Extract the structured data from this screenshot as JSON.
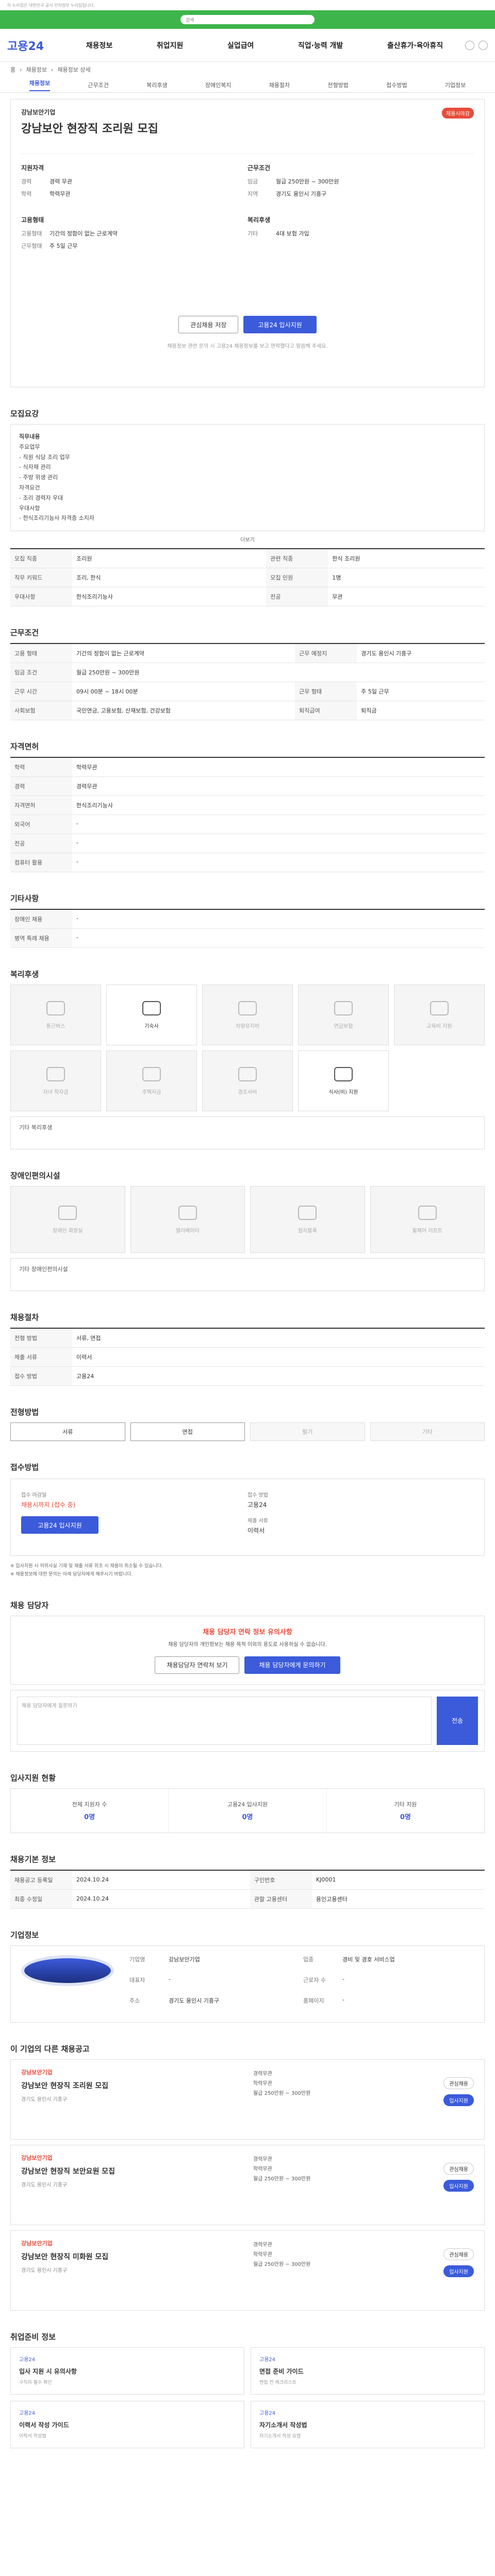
{
  "topbar": {
    "text": "이 누리집은 대한민국 공식 전자정부 누리집입니다."
  },
  "search": {
    "placeholder": "검색"
  },
  "header": {
    "logo": "고용24",
    "gnb": [
      "채용정보",
      "취업지원",
      "실업급여",
      "직업·능력 개발",
      "출산휴가·육아휴직"
    ]
  },
  "breadcrumb": [
    "홈",
    "채용정보",
    "채용정보 상세"
  ],
  "subnav": [
    "채용정보",
    "근무조건",
    "복리후생",
    "장애인복지",
    "채용절차",
    "전형방법",
    "접수방법",
    "기업정보"
  ],
  "posting": {
    "company": "강남보안기업",
    "title": "강남보안 현장직 조리원 모집",
    "status": "채용시마감",
    "left_head": "지원자격",
    "left": [
      {
        "k": "경력",
        "v": "경력 무관"
      },
      {
        "k": "학력",
        "v": "학력무관"
      }
    ],
    "left2_head": "고용형태",
    "left2": [
      {
        "k": "고용형태",
        "v": "기간의 정함이 없는 근로계약"
      },
      {
        "k": "근무형태",
        "v": "주 5일 근무"
      }
    ],
    "right_head": "근무조건",
    "right": [
      {
        "k": "임금",
        "v": "월급 250만원 ~ 300만원"
      },
      {
        "k": "지역",
        "v": "경기도 용인시 기흥구"
      }
    ],
    "right2_head": "복리후생",
    "right2": [
      {
        "k": "기타",
        "v": "4대 보험 가입"
      }
    ],
    "btn_save": "관심채용 저장",
    "btn_apply": "고용24 입사지원",
    "note": "채용정보 관련 문의 시 고용24 채용정보를 보고 연락했다고 말씀해 주세요."
  },
  "recruit": {
    "heading": "모집요강",
    "desc_title": "직무내용",
    "desc_lines": [
      "주요업무",
      "- 직원 식당 조리 업무",
      "- 식자재 관리",
      "- 주방 위생 관리",
      "자격요건",
      "- 조리 경력자 우대",
      "우대사항",
      "- 한식조리기능사 자격증 소지자"
    ],
    "more": "더보기",
    "rows": [
      {
        "k": "모집 직종",
        "v": "조리원"
      },
      {
        "k": "관련 직종",
        "v": "한식 조리원"
      },
      {
        "k": "직무 키워드",
        "v": "조리, 한식"
      },
      {
        "k": "모집 인원",
        "v": "1명"
      },
      {
        "k": "우대사항",
        "v": "한식조리기능사"
      },
      {
        "k": "전공",
        "v": "무관"
      }
    ]
  },
  "conditions": {
    "heading": "근무조건",
    "rows": [
      {
        "k": "고용 형태",
        "v": "기간의 정함이 없는 근로계약"
      },
      {
        "k": "근무 예정지",
        "v": "경기도 용인시 기흥구"
      },
      {
        "k": "임금 조건",
        "v": "월급 250만원 ~ 300만원"
      },
      {
        "k": "근무 시간",
        "v": "09시 00분 ~ 18시 00분"
      },
      {
        "k": "근무 형태",
        "v": "주 5일 근무"
      },
      {
        "k": "사회보험",
        "v": "국민연금, 고용보험, 산재보험, 건강보험"
      },
      {
        "k": "퇴직급여",
        "v": "퇴직금"
      }
    ]
  },
  "qualification": {
    "heading": "자격면허",
    "rows": [
      {
        "k": "학력",
        "v": "학력무관"
      },
      {
        "k": "경력",
        "v": "경력무관"
      },
      {
        "k": "자격면허",
        "v": "한식조리기능사"
      },
      {
        "k": "외국어",
        "v": "-"
      },
      {
        "k": "전공",
        "v": "-"
      },
      {
        "k": "컴퓨터 활용",
        "v": "-"
      }
    ]
  },
  "etc": {
    "heading": "기타사항",
    "rows": [
      {
        "k": "장애인 채용",
        "v": "-"
      },
      {
        "k": "병역 특례 채용",
        "v": "-"
      }
    ]
  },
  "welfare": {
    "heading": "복리후생",
    "items": [
      {
        "label": "통근버스",
        "on": false
      },
      {
        "label": "기숙사",
        "on": true
      },
      {
        "label": "차량유지비",
        "on": false
      },
      {
        "label": "연금보험",
        "on": false
      },
      {
        "label": "교육비 지원",
        "on": false
      },
      {
        "label": "자녀 학자금",
        "on": false
      },
      {
        "label": "주택자금",
        "on": false
      },
      {
        "label": "경조사비",
        "on": false
      },
      {
        "label": "식사(비) 지원",
        "on": true
      }
    ],
    "etc_label": "기타 복리후생"
  },
  "disability": {
    "heading": "장애인편의시설",
    "items": [
      "장애인 화장실",
      "엘리베이터",
      "점자블록",
      "휠체어 리프트"
    ],
    "etc_label": "기타 장애인편의시설"
  },
  "process": {
    "heading": "채용절차",
    "rows": [
      {
        "k": "전형 방법",
        "v": "서류, 면접"
      },
      {
        "k": "제출 서류",
        "v": "이력서"
      },
      {
        "k": "접수 방법",
        "v": "고용24"
      }
    ]
  },
  "method": {
    "heading": "전형방법",
    "types": [
      {
        "label": "서류",
        "on": true
      },
      {
        "label": "면접",
        "on": true
      },
      {
        "label": "필기",
        "on": false
      },
      {
        "label": "기타",
        "on": false
      }
    ]
  },
  "applyhow": {
    "heading": "접수방법",
    "left_k": "접수 마감일",
    "left_v": "채용시까지 (접수 중)",
    "btn": "고용24 입사지원",
    "right_k": "접수 방법",
    "right_v": "고용24",
    "right_k2": "제출 서류",
    "right_v2": "이력서",
    "notes": [
      "※ 입사지원 시 허위사실 기재 및 제출 서류 위조 시 채용이 취소될 수 있습니다.",
      "※ 채용정보에 대한 문의는 아래 담당자에게 해주시기 바랍니다."
    ]
  },
  "contact": {
    "heading": "채용 담당자",
    "warn_title": "채용 담당자 연락 정보 유의사항",
    "warn_text": "채용 담당자의 개인정보는 채용 목적 이외의 용도로 사용하실 수 없습니다.",
    "btn1": "채용담당자 연락처 보기",
    "btn2": "채용 담당자에게 문의하기",
    "q_placeholder": "채용 담당자에게 질문하기",
    "q_btn": "전송"
  },
  "applicants": {
    "heading": "입사지원 현황",
    "stats": [
      {
        "k": "전체 지원자 수",
        "v": "0명"
      },
      {
        "k": "고용24 입사지원",
        "v": "0명"
      },
      {
        "k": "기타 지원",
        "v": "0명"
      }
    ]
  },
  "info": {
    "heading": "채용기본 정보",
    "rows": [
      {
        "k": "채용공고 등록일",
        "v": "2024.10.24",
        "k2": "구인번호",
        "v2": "KJ0001"
      },
      {
        "k": "최종 수정일",
        "v": "2024.10.24",
        "k2": "관할 고용센터",
        "v2": "용인고용센터"
      }
    ]
  },
  "company": {
    "heading": "기업정보",
    "rows": [
      {
        "k": "기업명",
        "v": "강남보안기업",
        "k2": "업종",
        "v2": "경비 및 경호 서비스업"
      },
      {
        "k": "대표자",
        "v": "-",
        "k2": "근로자 수",
        "v2": "-"
      },
      {
        "k": "주소",
        "v": "경기도 용인시 기흥구",
        "k2": "홈페이지",
        "v2": "-"
      }
    ]
  },
  "others": {
    "heading": "이 기업의 다른 채용공고",
    "jobs": [
      {
        "co": "강남보안기업",
        "title": "강남보안 현장직 조리원 모집",
        "loc": "경기도 용인시 기흥구",
        "meta": [
          "경력무관",
          "학력무관",
          "월급 250만원 ~ 300만원"
        ]
      },
      {
        "co": "강남보안기업",
        "title": "강남보안 현장직 보안요원 모집",
        "loc": "경기도 용인시 기흥구",
        "meta": [
          "경력무관",
          "학력무관",
          "월급 250만원 ~ 300만원"
        ]
      },
      {
        "co": "강남보안기업",
        "title": "강남보안 현장직 미화원 모집",
        "loc": "경기도 용인시 기흥구",
        "meta": [
          "경력무관",
          "학력무관",
          "월급 250만원 ~ 300만원"
        ]
      }
    ],
    "act1": "관심채용",
    "act2": "입사지원"
  },
  "tips": {
    "heading": "취업준비 정보",
    "items": [
      {
        "t": "고용24",
        "h": "입사 지원 시 유의사항",
        "d": "구직자 필수 확인"
      },
      {
        "t": "고용24",
        "h": "면접 준비 가이드",
        "d": "면접 전 체크리스트"
      },
      {
        "t": "고용24",
        "h": "이력서 작성 가이드",
        "d": "이력서 작성법"
      },
      {
        "t": "고용24",
        "h": "자기소개서 작성법",
        "d": "자기소개서 작성 요령"
      }
    ]
  }
}
